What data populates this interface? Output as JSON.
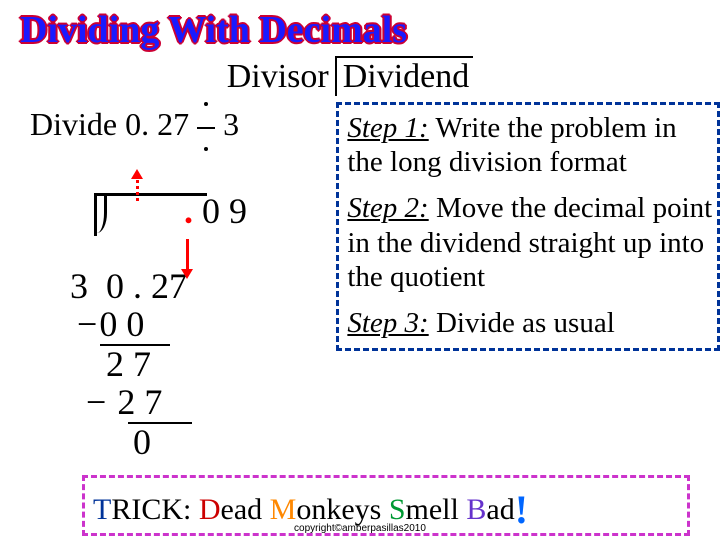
{
  "title": "Dividing With  Decimals",
  "labels": {
    "divisor": "Divisor",
    "dividend": "Dividend"
  },
  "problem": {
    "prefix": "Divide  ",
    "dividend_num": "0. 27",
    "divisor_num": "3"
  },
  "longdiv": {
    "quotient_dot": ". ",
    "quotient_digits": "0 9",
    "divisor": "3",
    "dividend": "0 . 27",
    "sub1": "0 0",
    "rem1": "2 7",
    "sub2": "2 7",
    "rem2": "0"
  },
  "steps": {
    "s1_label": "Step 1:",
    "s1_text": "  Write the problem in the long division format",
    "s2_label": "Step 2:",
    "s2_text": " Move the decimal point in the dividend straight up into the quotient",
    "s3_label": "Step 3:",
    "s3_text": " Divide as usual"
  },
  "trick": {
    "t": "T",
    "rick": "RICK:  ",
    "d": "D",
    "ead": "ead ",
    "m": "M",
    "onkeys": "onkeys ",
    "s": "S",
    "mell": "mell ",
    "b": "B",
    "ad": "ad",
    "excl": "!"
  },
  "copyright": "copyright©amberpasillas2010"
}
